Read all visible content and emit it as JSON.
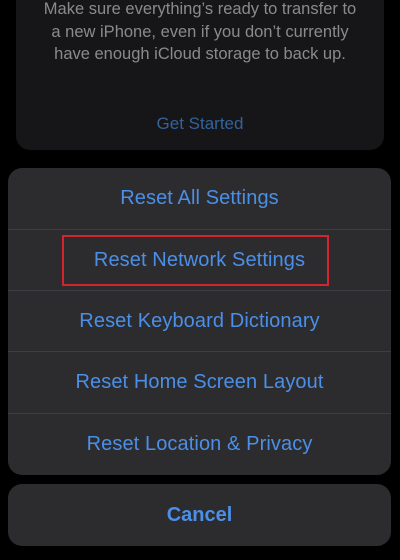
{
  "background_card": {
    "description_lines": [
      "Make sure everything’s ready to transfer to",
      "a new iPhone, even if you don’t currently",
      "have enough iCloud storage to back up."
    ],
    "link_label": "Get Started"
  },
  "action_sheet": {
    "items": [
      {
        "label": "Reset All Settings"
      },
      {
        "label": "Reset Network Settings",
        "highlighted": true
      },
      {
        "label": "Reset Keyboard Dictionary"
      },
      {
        "label": "Reset Home Screen Layout"
      },
      {
        "label": "Reset Location & Privacy"
      }
    ],
    "cancel_label": "Cancel"
  },
  "colors": {
    "background": "#000000",
    "card": "#1c1c1e",
    "sheet": "#2c2c2e",
    "action_blue": "#4b8fe8",
    "highlight_red": "#d6232f",
    "secondary_text": "#a9a9ad"
  }
}
